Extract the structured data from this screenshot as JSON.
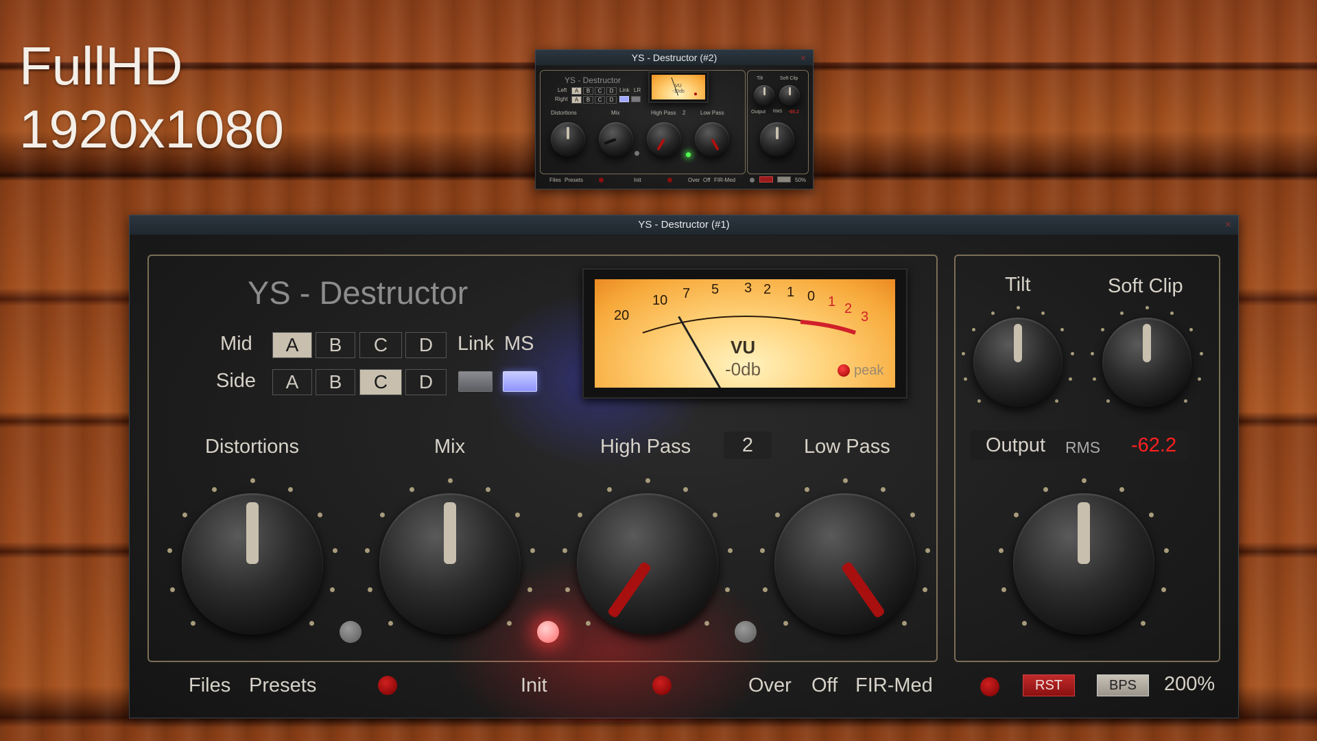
{
  "overlay": {
    "line1": "FullHD",
    "line2": "1920x1080"
  },
  "win1": {
    "title": "YS - Destructor (#1)",
    "plugin_name": "YS - Destructor",
    "mid_label": "Mid",
    "side_label": "Side",
    "mid_buttons": [
      "A",
      "B",
      "C",
      "D"
    ],
    "side_buttons": [
      "A",
      "B",
      "C",
      "D"
    ],
    "mid_selected": "A",
    "side_selected": "C",
    "link_label": "Link",
    "ms_label": "MS",
    "vu": {
      "scale_black": [
        "20",
        "10",
        "7",
        "5",
        "3",
        "2",
        "1",
        "0"
      ],
      "scale_red": [
        "1",
        "2",
        "3"
      ],
      "label": "VU",
      "value": "-0db",
      "peak_label": "peak"
    },
    "knobs": {
      "distortions": "Distortions",
      "mix": "Mix",
      "high_pass": "High Pass",
      "low_pass": "Low Pass",
      "tilt": "Tilt",
      "soft_clip": "Soft Clip"
    },
    "high_pass_value": "2",
    "output": {
      "label": "Output",
      "mode": "RMS",
      "value": "-62.2"
    },
    "bottom": {
      "files": "Files",
      "presets": "Presets",
      "init": "Init",
      "over": "Over",
      "off": "Off",
      "fir": "FIR-Med",
      "rst": "RST",
      "bps": "BPS",
      "zoom": "200%"
    }
  },
  "win2": {
    "title": "YS - Destructor (#2)",
    "plugin_name": "YS - Destructor",
    "left_label": "Left",
    "right_label": "Right",
    "buttons": [
      "A",
      "B",
      "C",
      "D"
    ],
    "link_label": "Link",
    "lr_label": "LR",
    "vu_label": "VU",
    "vu_value": "-10db",
    "knobs": {
      "distortions": "Distortions",
      "mix": "Mix",
      "high_pass": "High Pass",
      "low_pass": "Low Pass",
      "tilt": "Tilt",
      "soft_clip": "Soft Clip"
    },
    "high_pass_value": "2",
    "output": {
      "label": "Output",
      "mode": "RMS",
      "value": "-60.2"
    },
    "bottom": {
      "files": "Files",
      "presets": "Presets",
      "init": "Init",
      "over": "Over",
      "off": "Off",
      "fir": "FIR-Med",
      "zoom": "50%"
    }
  }
}
